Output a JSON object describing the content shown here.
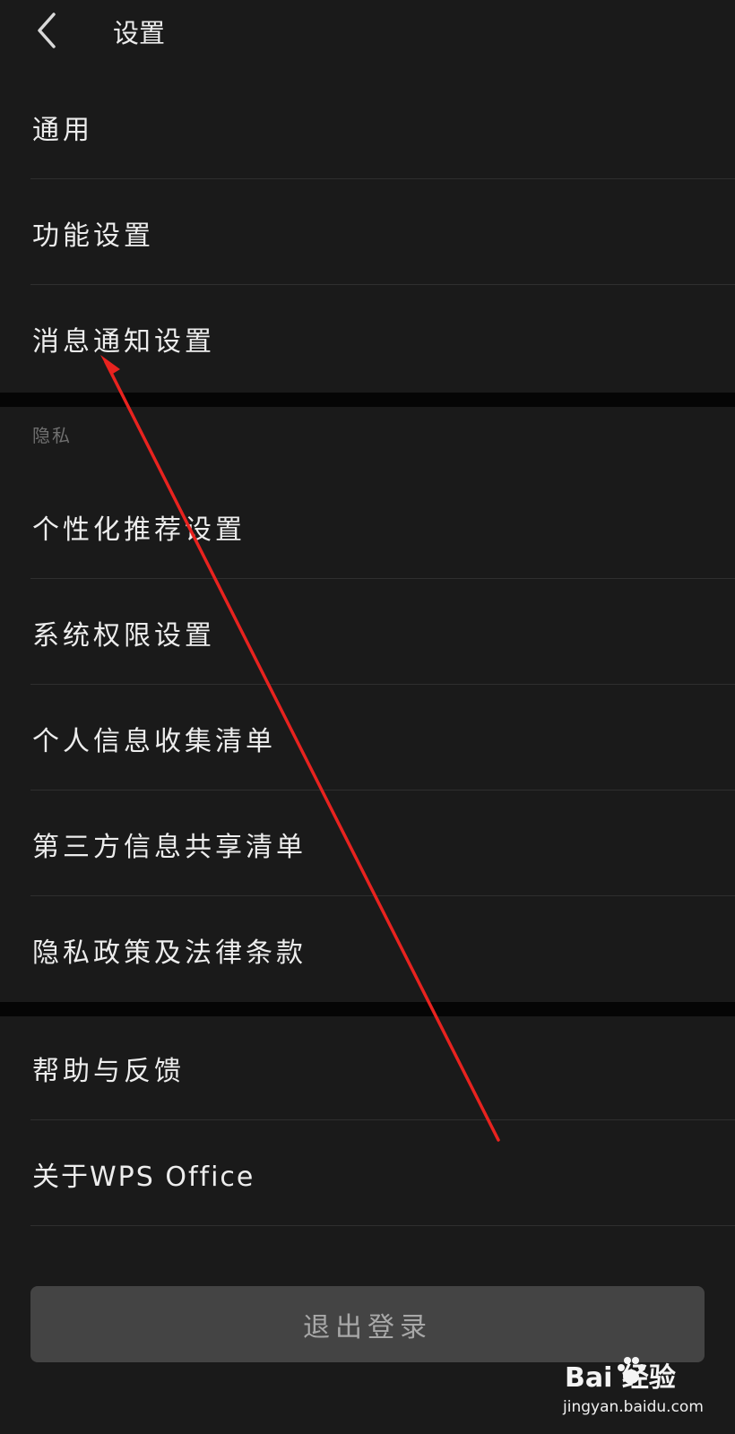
{
  "header": {
    "title": "设置",
    "back_icon": "chevron-left-icon"
  },
  "sections": {
    "general": {
      "items": [
        {
          "label": "通用"
        },
        {
          "label": "功能设置"
        },
        {
          "label": "消息通知设置"
        }
      ]
    },
    "privacy": {
      "title": "隐私",
      "items": [
        {
          "label": "个性化推荐设置"
        },
        {
          "label": "系统权限设置"
        },
        {
          "label": "个人信息收集清单"
        },
        {
          "label": "第三方信息共享清单"
        },
        {
          "label": "隐私政策及法律条款"
        }
      ]
    },
    "other": {
      "items": [
        {
          "label": "帮助与反馈"
        },
        {
          "label": "关于WPS Office"
        }
      ]
    }
  },
  "logout": {
    "label": "退出登录"
  },
  "watermark": {
    "logo_text": "Bai   经验",
    "url": "jingyan.baidu.com"
  },
  "colors": {
    "background": "#1a1a1a",
    "separator": "#050505",
    "text": "#ededed",
    "muted_text": "#6f6f6f",
    "button_bg": "#444444",
    "annotation_arrow": "#e8231f"
  }
}
